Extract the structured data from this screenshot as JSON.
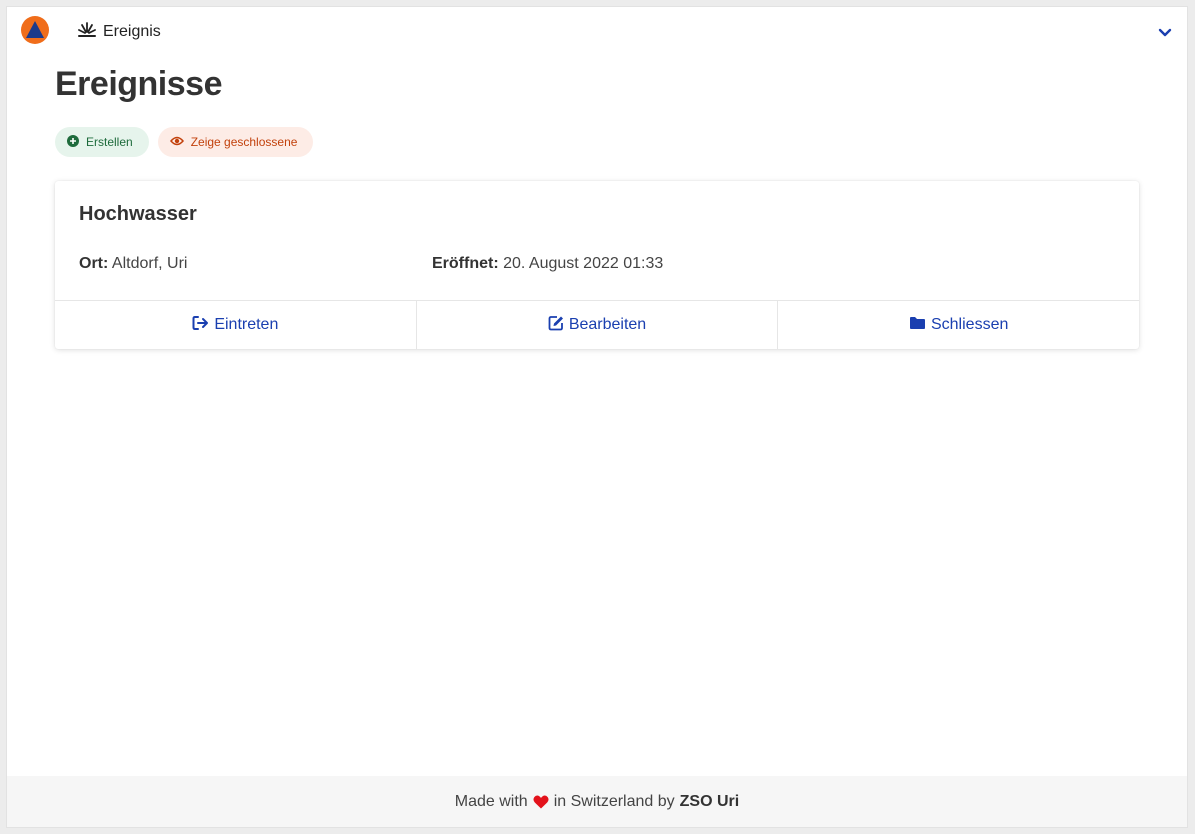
{
  "nav": {
    "logo_icon": "civil-protection-logo",
    "item_label": "Ereignis",
    "item_icon": "explosion-icon",
    "toggle_icon": "chevron-down-icon"
  },
  "page": {
    "title": "Ereignisse"
  },
  "actions": {
    "create_label": "Erstellen",
    "create_icon": "plus-circle-icon",
    "show_closed_label": "Zeige geschlossene",
    "show_closed_icon": "eye-icon"
  },
  "events": [
    {
      "title": "Hochwasser",
      "location_label": "Ort:",
      "location_value": "Altdorf, Uri",
      "opened_label": "Eröffnet:",
      "opened_value": "20. August 2022 01:33",
      "buttons": {
        "enter": "Eintreten",
        "edit": "Bearbeiten",
        "close": "Schliessen"
      }
    }
  ],
  "footer": {
    "prefix": "Made with",
    "suffix": "in Switzerland by",
    "org": "ZSO Uri"
  },
  "colors": {
    "accent_blue": "#1a3fb0",
    "logo_orange": "#f06d1a",
    "logo_blue": "#1d3a8a",
    "chip_green_bg": "#e6f4ec",
    "chip_green_text": "#1e6b3c",
    "chip_red_bg": "#fdece6",
    "chip_red_text": "#c2410c",
    "heart_red": "#e3121b"
  }
}
